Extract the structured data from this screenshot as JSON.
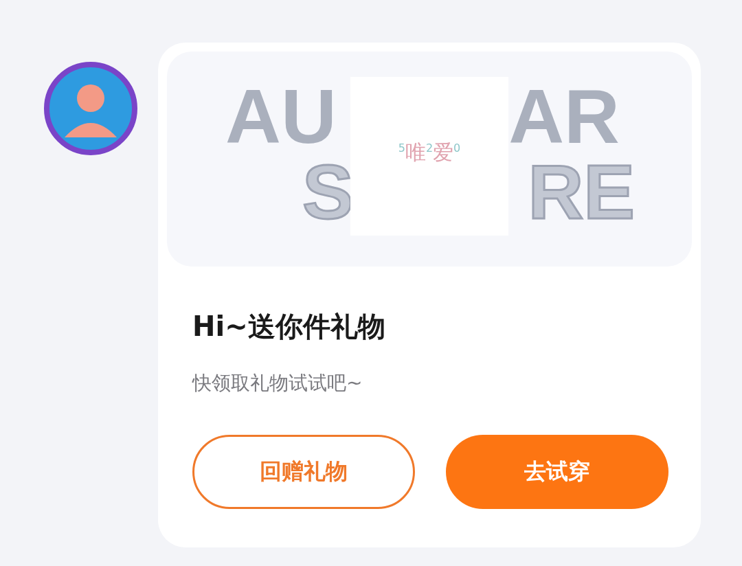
{
  "banner": {
    "line_1": [
      "AU",
      "AR"
    ],
    "line_2": [
      "S",
      "RE"
    ],
    "item_label": "$^{5}$唯$^{2}$爱$^{0}$"
  },
  "title": "Hi~送你件礼物",
  "subtitle": "快领取礼物试试吧~",
  "buttons": [
    {
      "label": "回赠礼物",
      "kind": "outline"
    },
    {
      "label": "去试穿",
      "kind": "filled"
    }
  ]
}
